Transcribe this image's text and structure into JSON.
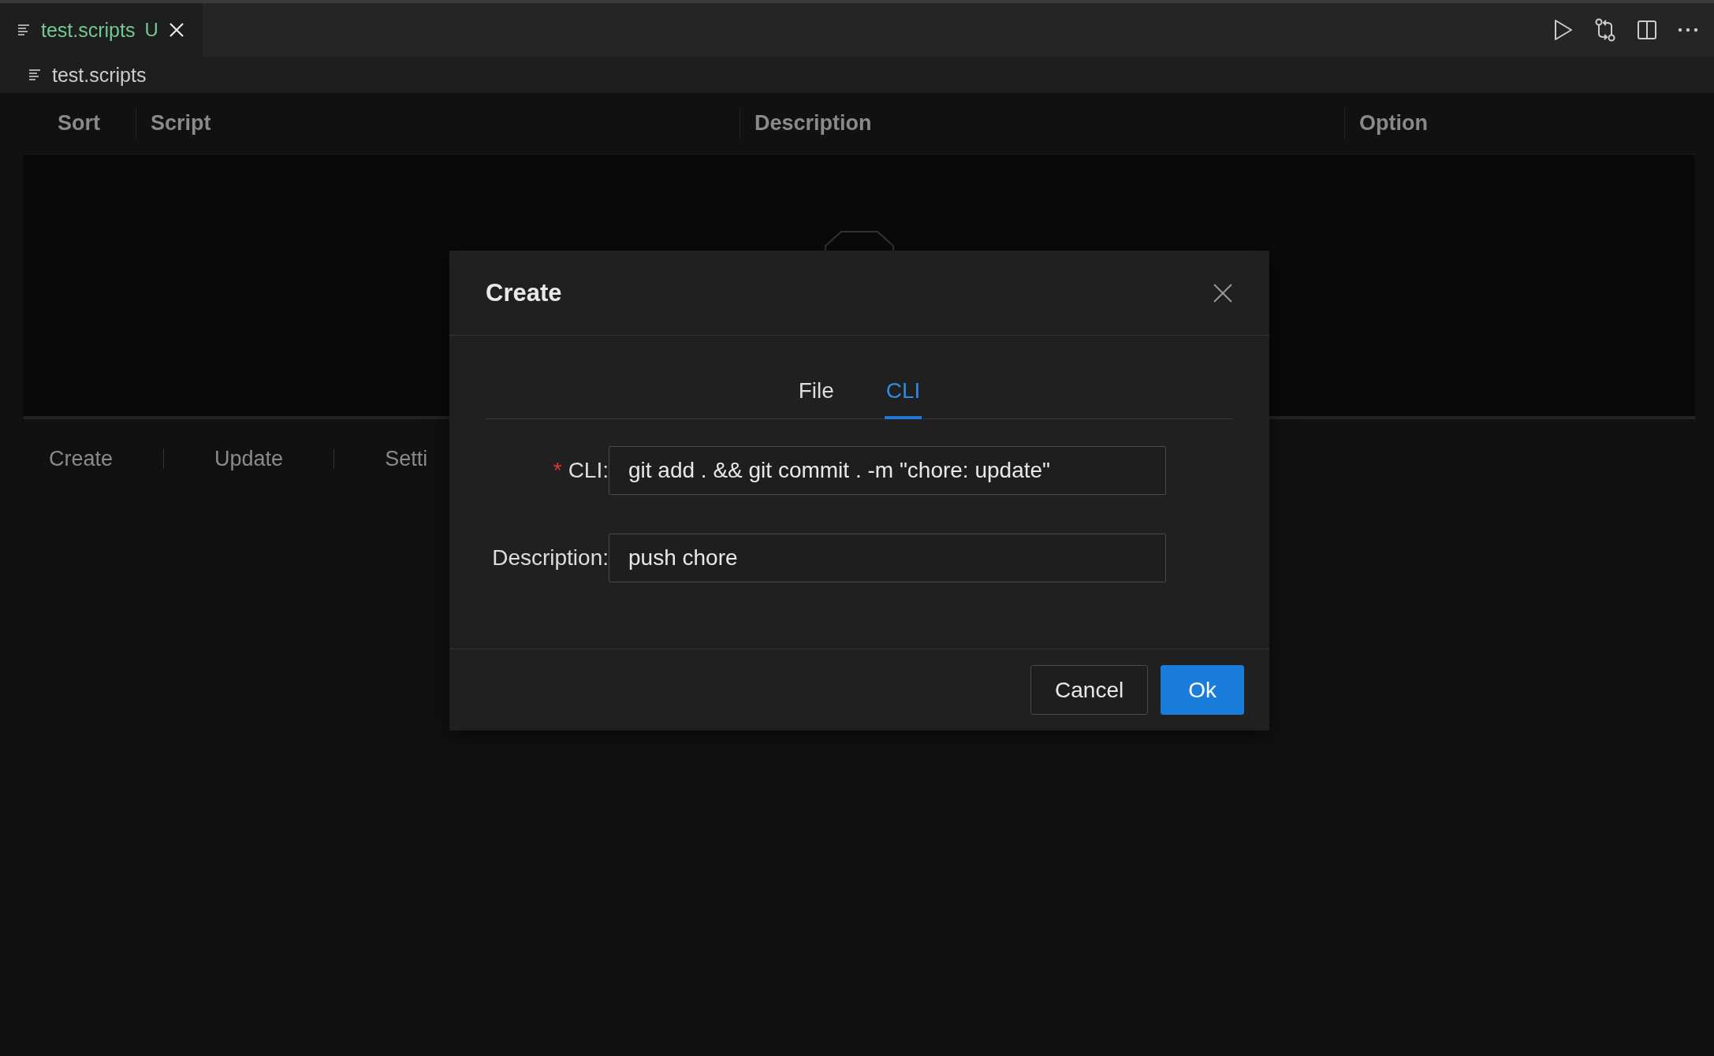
{
  "editor_tabs": [
    {
      "label": "test.scripts",
      "status": "U",
      "selected": true
    }
  ],
  "breadcrumb": "test.scripts",
  "table": {
    "columns": [
      "Sort",
      "Script",
      "Description",
      "Option"
    ]
  },
  "bottom_tabs": [
    "Create",
    "Update",
    "Setti"
  ],
  "dialog": {
    "title": "Create",
    "tabs": [
      {
        "label": "File",
        "selected": false
      },
      {
        "label": "CLI",
        "selected": true
      }
    ],
    "fields": [
      {
        "label": "CLI:",
        "required_mark": "*",
        "value": "git add . && git commit . -m \"chore: update\""
      },
      {
        "label": "Description:",
        "value": "push chore"
      }
    ],
    "buttons": [
      {
        "label": "Cancel",
        "kind": "default"
      },
      {
        "label": "Ok",
        "kind": "primary"
      }
    ]
  }
}
